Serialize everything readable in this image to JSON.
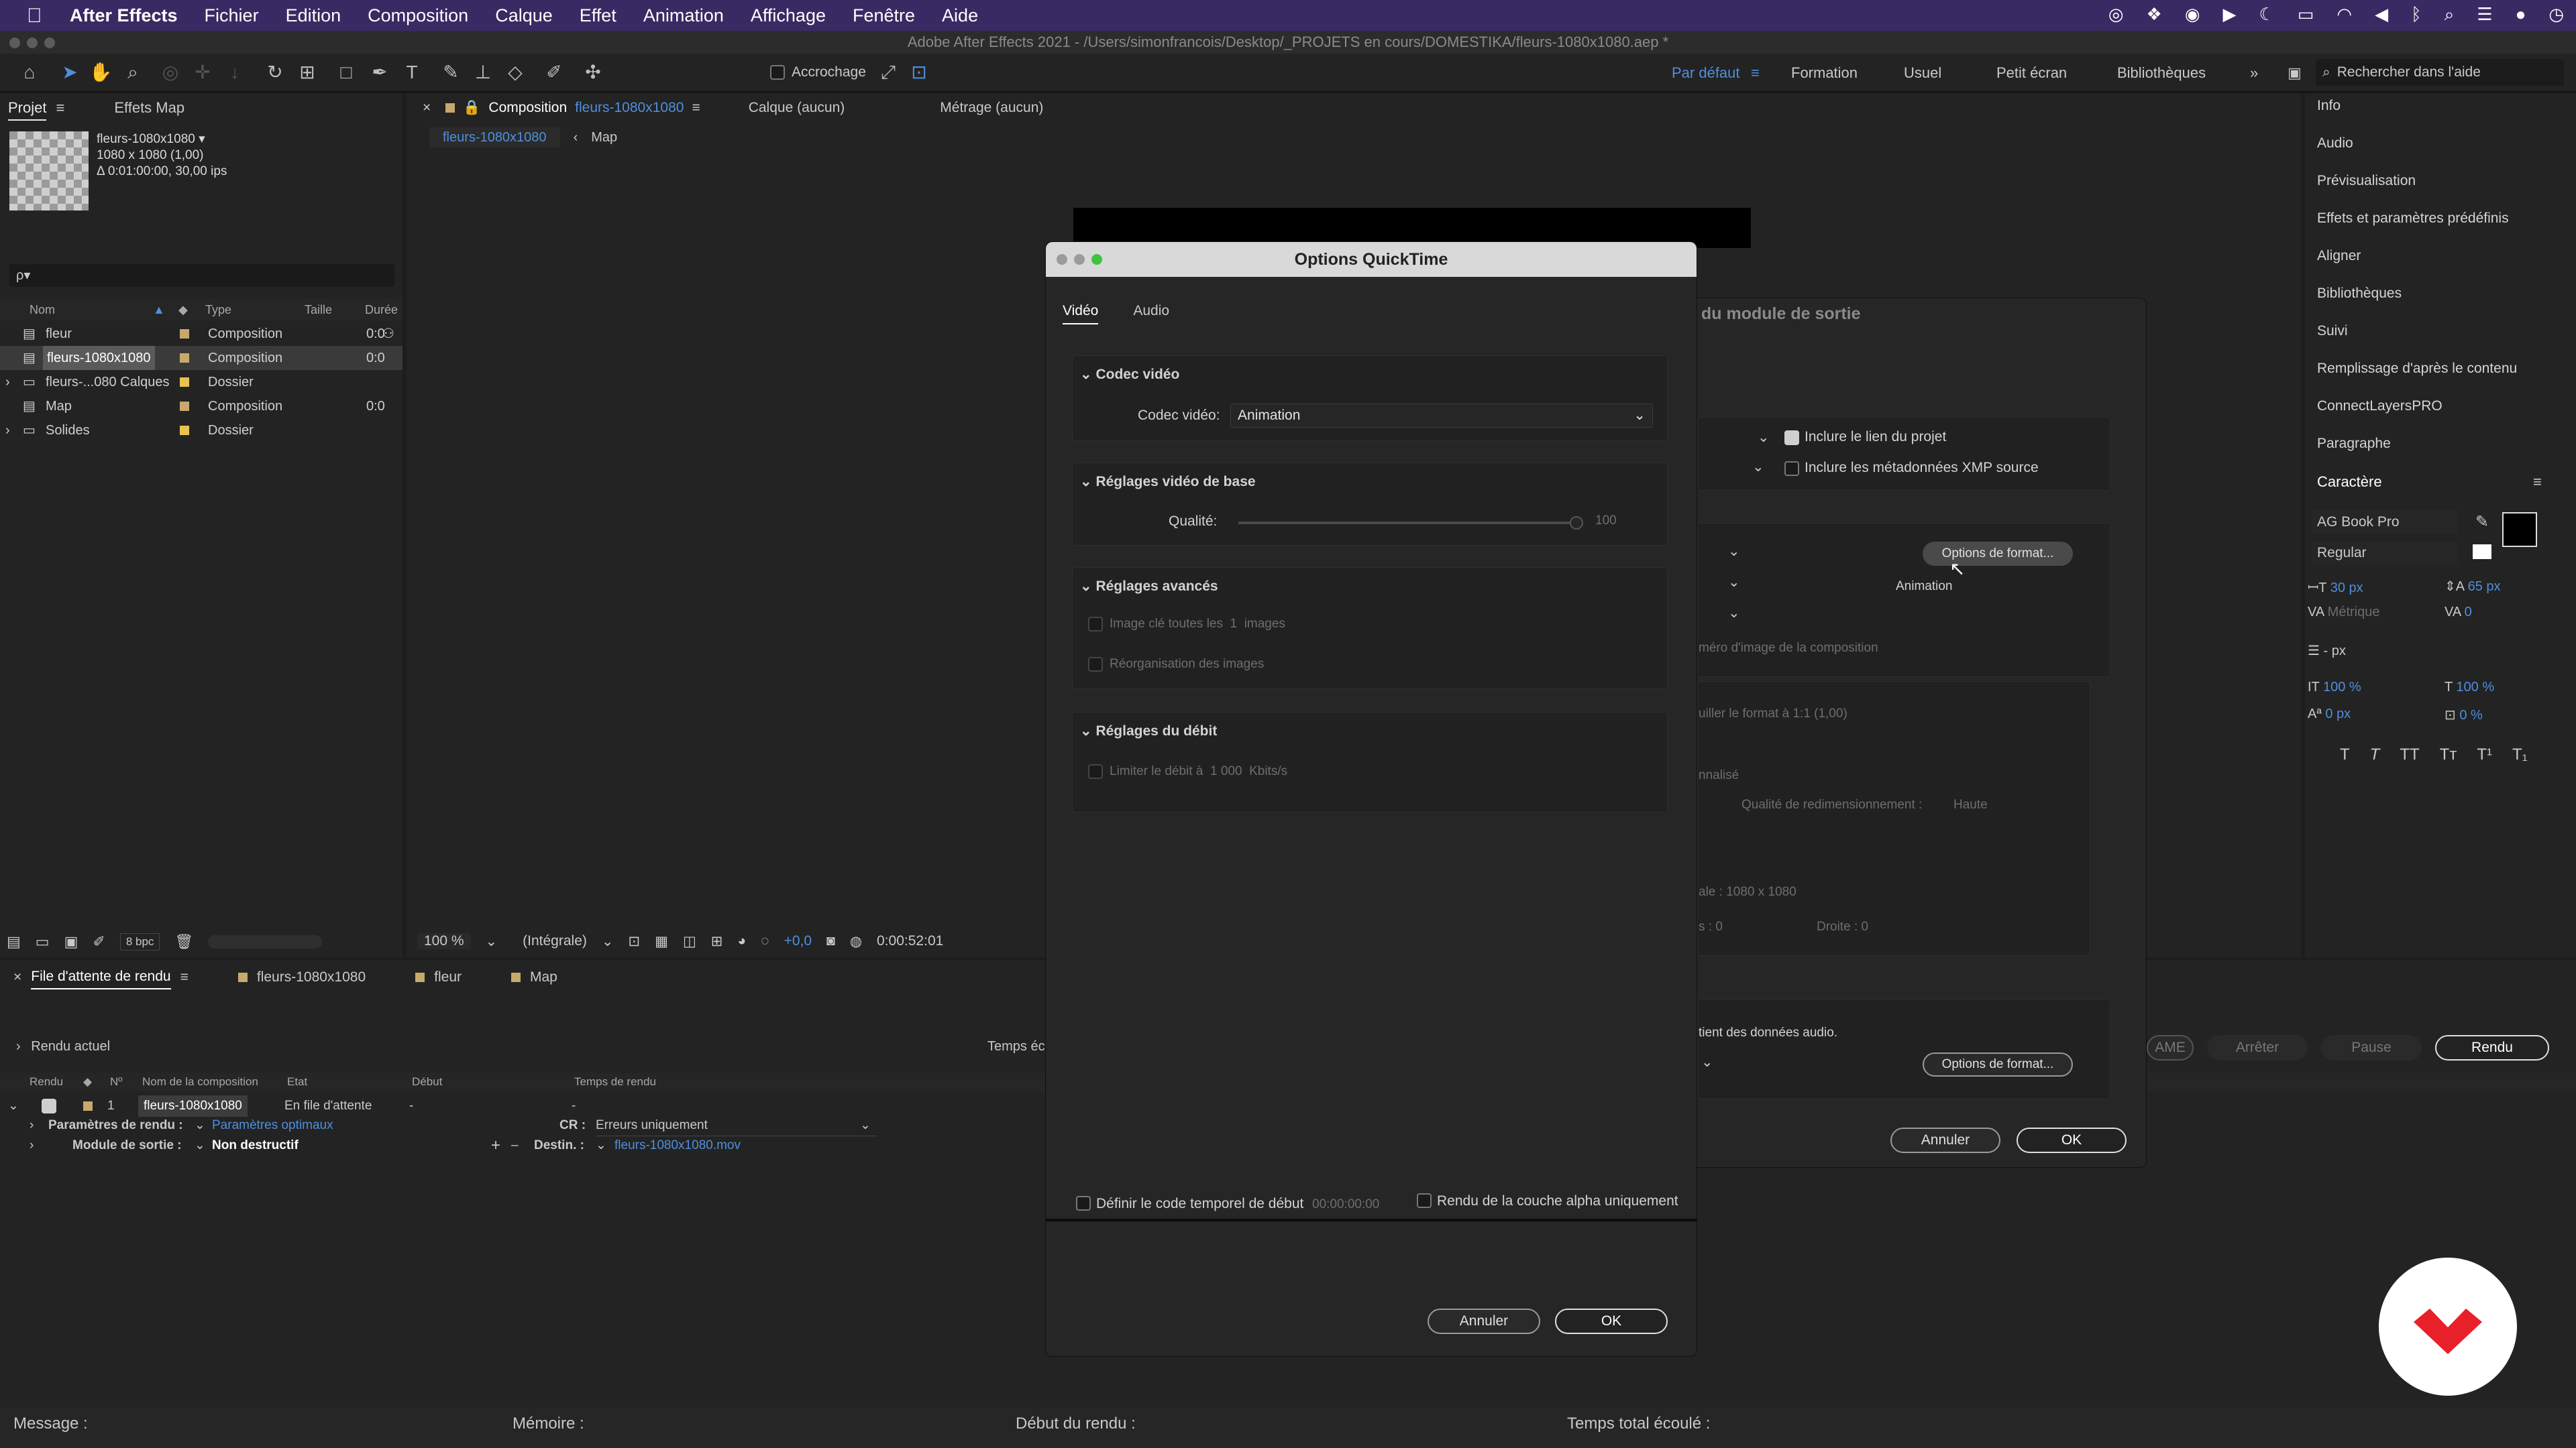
{
  "menubar": {
    "app": "After Effects",
    "items": [
      "Fichier",
      "Edition",
      "Composition",
      "Calque",
      "Effet",
      "Animation",
      "Affichage",
      "Fenêtre",
      "Aide"
    ]
  },
  "titlebar": {
    "title": "Adobe After Effects 2021 - /Users/simonfrancois/Desktop/_PROJETS en cours/DOMESTIKA/fleurs-1080x1080.aep *"
  },
  "toolbar": {
    "snap_label": "Accrochage",
    "workspaces": [
      "Par défaut",
      "Formation",
      "Usuel",
      "Petit écran",
      "Bibliothèques"
    ],
    "search_placeholder": "Rechercher dans l'aide"
  },
  "project": {
    "tabs": [
      "Projet",
      "Effets Map"
    ],
    "item_name": "fleurs-1080x1080 ▾",
    "item_size": "1080 x 1080 (1,00)",
    "item_duration": "Δ 0:01:00:00, 30,00 ips",
    "search_placeholder": "ρ▾",
    "columns": [
      "Nom",
      "Type",
      "Taille",
      "Durée"
    ],
    "rows": [
      {
        "name": "fleur",
        "type": "Composition",
        "dur": "0:0",
        "color": "#c8a96b"
      },
      {
        "name": "fleurs-1080x1080",
        "type": "Composition",
        "dur": "0:0",
        "color": "#c8a96b"
      },
      {
        "name": "fleurs-...080 Calques",
        "type": "Dossier",
        "dur": "",
        "color": "#e6c34d"
      },
      {
        "name": "Map",
        "type": "Composition",
        "dur": "0:0",
        "color": "#c8a96b"
      },
      {
        "name": "Solides",
        "type": "Dossier",
        "dur": "",
        "color": "#e6c34d"
      }
    ],
    "bpc": "8 bpc"
  },
  "viewer": {
    "tabs": [
      "Composition",
      "fleurs-1080x1080",
      "Calque  (aucun)",
      "Métrage  (aucun)"
    ],
    "breadcrumbs": [
      "fleurs-1080x1080",
      "Map"
    ],
    "zoom": "100 %",
    "resolution": "(Intégrale)",
    "exposure": "+0,0",
    "time": "0:00:52:01"
  },
  "render": {
    "tabs": [
      "File d'attente de rendu",
      "fleurs-1080x1080",
      "fleur",
      "Map"
    ],
    "current": "Rendu actuel",
    "elapsed_label": "Temps éc",
    "columns": [
      "Rendu",
      "Nº",
      "Nom de la composition",
      "Etat",
      "Début",
      "Temps de rendu"
    ],
    "item": {
      "num": "1",
      "name": "fleurs-1080x1080",
      "state": "En file d'attente",
      "start": "-",
      "time": "-"
    },
    "settings_label": "Paramètres de rendu :",
    "settings_value": "Paramètres optimaux",
    "log_label": "CR :",
    "log_value": "Erreurs uniquement",
    "output_label": "Module de sortie :",
    "output_value": "Non destructif",
    "dest_label": "Destin. :",
    "dest_value": "fleurs-1080x1080.mov",
    "buttons": [
      "AME",
      "Arrêter",
      "Pause",
      "Rendu"
    ]
  },
  "status": {
    "message": "Message :",
    "memory": "Mémoire :",
    "start": "Début du rendu :",
    "total": "Temps total écoulé :"
  },
  "right_panel": {
    "items": [
      "Info",
      "Audio",
      "Prévisualisation",
      "Effets et paramètres prédéfinis",
      "Aligner",
      "Bibliothèques",
      "Suivi",
      "Remplissage d'après le contenu",
      "ConnectLayersPRO",
      "Paragraphe"
    ],
    "char_title": "Caractère",
    "font": "AG Book Pro",
    "style": "Regular",
    "size": "30 px",
    "leading": "65 px",
    "kerning": "Métrique",
    "tracking": "0",
    "stroke": "- px",
    "vscale": "100 %",
    "hscale": "100 %",
    "baseline": "0 px",
    "tsume": "0 %",
    "style_buttons": [
      "T",
      "T",
      "TT",
      "Tт",
      "T¹",
      "T₁"
    ]
  },
  "output_module": {
    "title": "du module de sortie",
    "include_link": "Inclure le lien du projet",
    "include_xmp": "Inclure les métadonnées XMP source",
    "format_options": "Options de format...",
    "format_value": "Animation",
    "frame_text": "méro d'image de la composition",
    "lock_text": "uiller le format à 1:1 (1,00)",
    "custom": "nnalisé",
    "resize_quality_label": "Qualité de redimensionnement :",
    "resize_quality": "Haute",
    "crop_size": "ale : 1080 x 1080",
    "crop_s": "s : 0",
    "crop_right": "Droite : 0",
    "audio_text": "tient des données audio.",
    "audio_format_options": "Options de format...",
    "cancel": "Annuler",
    "ok": "OK"
  },
  "quicktime": {
    "title": "Options QuickTime",
    "tabs": [
      "Vidéo",
      "Audio"
    ],
    "codec_section": "Codec vidéo",
    "codec_label": "Codec vidéo:",
    "codec_value": "Animation",
    "basic_section": "Réglages vidéo de base",
    "quality_label": "Qualité:",
    "quality_value": "100",
    "advanced_section": "Réglages avancés",
    "keyframe": "Image clé toutes les",
    "keyframe_num": "1",
    "keyframe_unit": "images",
    "reorder": "Réorganisation des images",
    "bitrate_section": "Réglages du débit",
    "bitrate_limit": "Limiter le débit à",
    "bitrate_value": "1 000",
    "bitrate_unit": "Kbits/s",
    "timecode": "Définir le code temporel de début",
    "timecode_value": "00:00:00:00",
    "alpha": "Rendu de la couche alpha uniquement",
    "cancel": "Annuler",
    "ok": "OK"
  }
}
